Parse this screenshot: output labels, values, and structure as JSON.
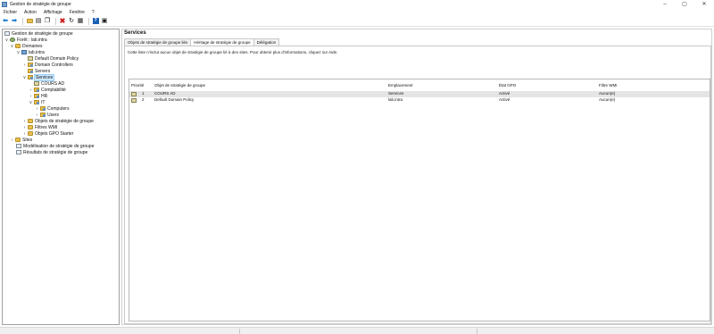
{
  "window": {
    "title": "Gestion de stratégie de groupe",
    "controls": [
      "–",
      "▢",
      "✕"
    ]
  },
  "menu": [
    "Fichier",
    "Action",
    "Affichage",
    "Fenêtre",
    "?"
  ],
  "tree": {
    "root": "Gestion de stratégie de groupe",
    "forest": "Forêt : lab.intra",
    "domains": "Domaines",
    "domain": "lab.intra",
    "default_policy": "Default Domain Policy",
    "domain_controllers": "Domain Controllers",
    "servers": "Servers",
    "services": "Services",
    "cours_ad": "COURS AD",
    "comptabilite": "Comptabilité",
    "hr": "HR",
    "it": "IT",
    "computers": "Computers",
    "users": "Users",
    "gpo_objects": "Objets de stratégie de groupe",
    "wmi_filters": "Filtres WMI",
    "starter_gpo": "Objets GPO Starter",
    "sites": "Sites",
    "modeling": "Modélisation de stratégie de groupe",
    "results": "Résultats de stratégie de groupe"
  },
  "main": {
    "title": "Services",
    "tabs": [
      "Objets de stratégie de groupe liés",
      "Héritage de stratégie de groupe",
      "Délégation"
    ],
    "info": "Cette liste n'inclut aucun objet de stratégie de groupe lié à des sites. Pour obtenir plus d'informations, cliquez sur Aide.",
    "columns": {
      "priority": "Priorité",
      "gpo": "Objet de stratégie de groupe",
      "location": "Emplacement",
      "state": "État GPO",
      "wmi": "Filtre WMI"
    },
    "rows": [
      {
        "priority": "1",
        "gpo": "COURS AD",
        "location": "Services",
        "state": "Activé",
        "wmi": "Aucun(e)"
      },
      {
        "priority": "2",
        "gpo": "Default Domain Policy",
        "location": "lab.intra",
        "state": "Activé",
        "wmi": "Aucun(e)"
      }
    ]
  }
}
